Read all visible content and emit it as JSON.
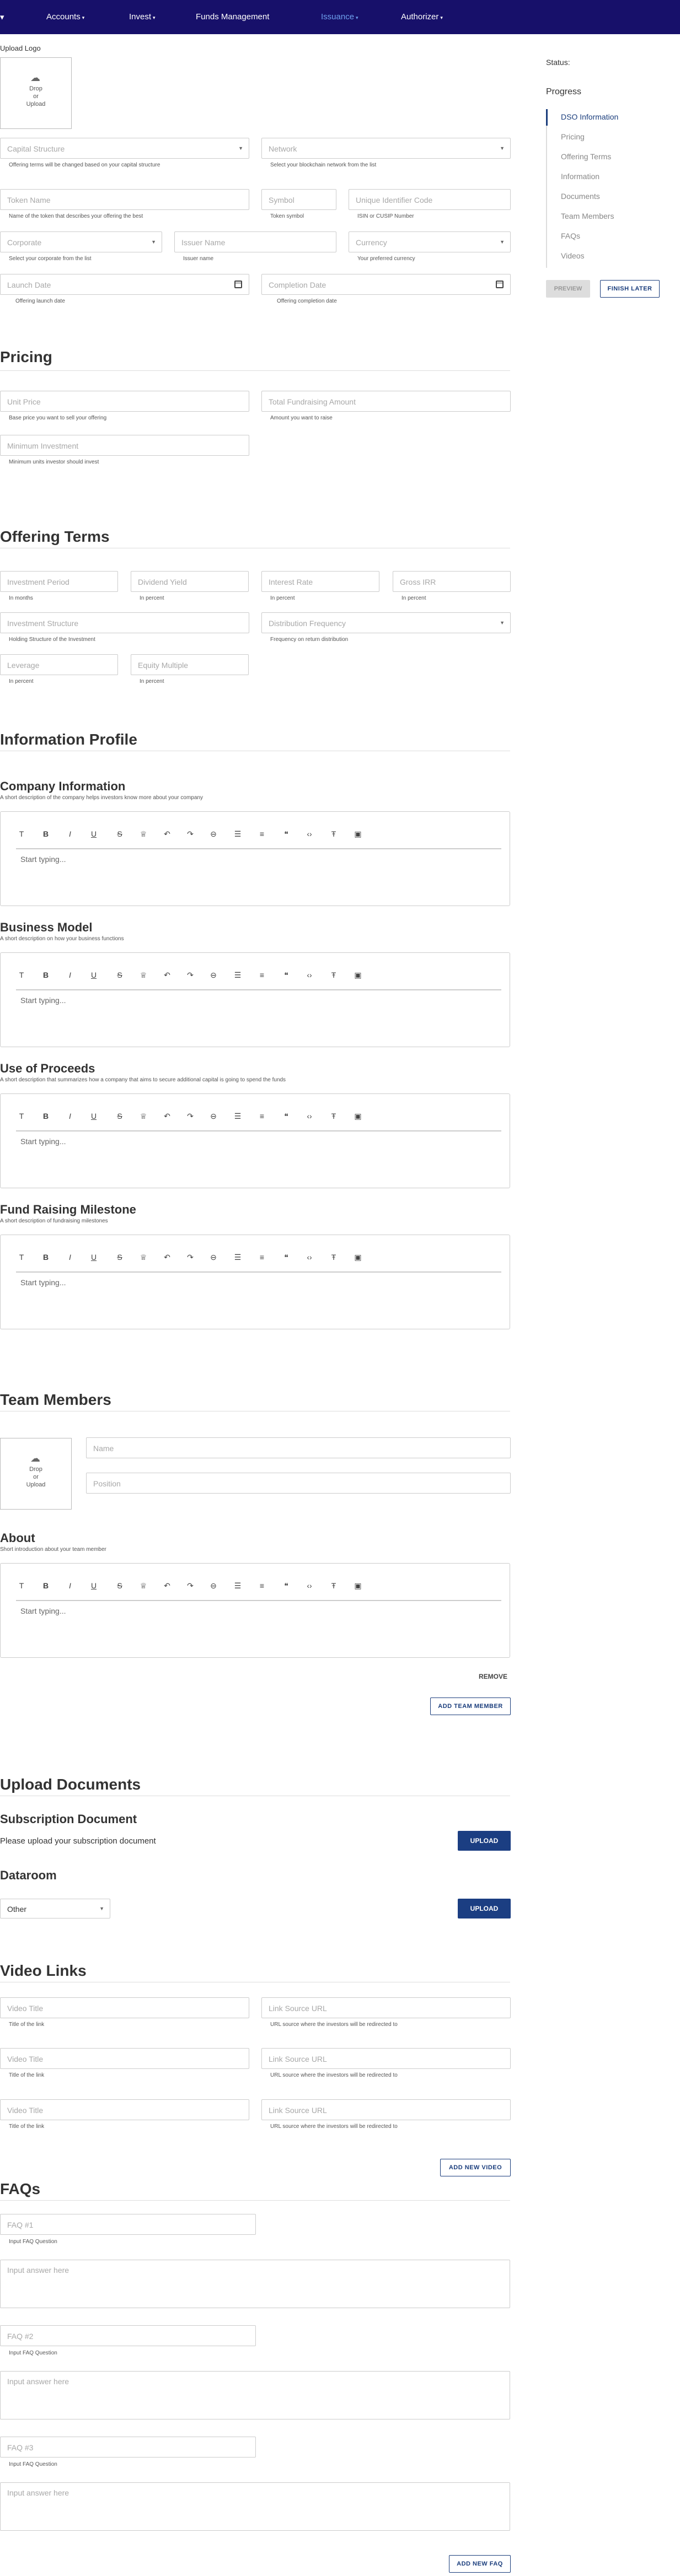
{
  "nav": [
    {
      "label": "Accounts"
    },
    {
      "label": "Invest"
    },
    {
      "label": "Funds Management"
    },
    {
      "label": "Issuance"
    },
    {
      "label": "Authorizer"
    }
  ],
  "upload_logo": {
    "label": "Upload Logo",
    "drop": "Drop",
    "or": "or",
    "upload": "Upload"
  },
  "dso": {
    "capital_structure": {
      "placeholder": "Capital Structure",
      "help": "Offering terms will be changed based on your capital structure"
    },
    "network": {
      "placeholder": "Network",
      "help": "Select your blockchain network from the list"
    },
    "token_name": {
      "placeholder": "Token Name",
      "help": "Name of the token that describes your offering the best"
    },
    "symbol": {
      "placeholder": "Symbol",
      "help": "Token symbol"
    },
    "uid": {
      "placeholder": "Unique Identifier Code",
      "help": "ISIN or CUSIP Number"
    },
    "corporate": {
      "placeholder": "Corporate",
      "help": "Select your corporate from the list"
    },
    "issuer": {
      "placeholder": "Issuer Name",
      "help": "Issuer name"
    },
    "currency": {
      "placeholder": "Currency",
      "help": "Your preferred currency"
    },
    "launch": {
      "placeholder": "Launch Date",
      "help": "Offering launch date"
    },
    "completion": {
      "placeholder": "Completion Date",
      "help": "Offering completion date"
    }
  },
  "pricing": {
    "title": "Pricing",
    "unit_price": {
      "placeholder": "Unit Price",
      "help": "Base price you want to sell your offering"
    },
    "total": {
      "placeholder": "Total Fundraising Amount",
      "help": "Amount you want to raise"
    },
    "minimum": {
      "placeholder": "Minimum Investment",
      "help": "Minimum units investor should invest"
    }
  },
  "offering": {
    "title": "Offering Terms",
    "period": {
      "placeholder": "Investment Period",
      "help": "In months"
    },
    "dividend": {
      "placeholder": "Dividend Yield",
      "help": "In percent"
    },
    "interest": {
      "placeholder": "Interest Rate",
      "help": "In percent"
    },
    "irr": {
      "placeholder": "Gross IRR",
      "help": "In percent"
    },
    "structure": {
      "placeholder": "Investment Structure",
      "help": "Holding Structure of the Investment"
    },
    "distribution": {
      "placeholder": "Distribution Frequency",
      "help": "Frequency on return distribution"
    },
    "leverage": {
      "placeholder": "Leverage",
      "help": "In percent"
    },
    "equity": {
      "placeholder": "Equity Multiple",
      "help": "In percent"
    }
  },
  "info": {
    "title": "Information Profile",
    "start": "Start typing...",
    "company": {
      "title": "Company Information",
      "desc": "A short description of the company helps investors know more about your company"
    },
    "business": {
      "title": "Business Model",
      "desc": "A short description on how your business functions"
    },
    "proceeds": {
      "title": "Use of Proceeds",
      "desc": "A short description that summarizes how a company that aims to secure additional capital is going to spend the funds"
    },
    "milestone": {
      "title": "Fund Raising Milestone",
      "desc": "A short description of fundraising milestones"
    }
  },
  "team": {
    "title": "Team Members",
    "name": "Name",
    "position": "Position",
    "about_title": "About",
    "about_desc": "Short introduction about your team member",
    "remove": "REMOVE",
    "add": "ADD TEAM MEMBER"
  },
  "documents": {
    "title": "Upload Documents",
    "sub_title": "Subscription Document",
    "sub_desc": "Please upload your subscription document",
    "upload": "UPLOAD",
    "dataroom_title": "Dataroom",
    "dataroom_value": "Other"
  },
  "videos": {
    "title": "Video Links",
    "video_title": "Video Title",
    "video_help": "Title of the link",
    "link": "Link Source URL",
    "link_help": "URL source where the investors will be redirected to",
    "add": "ADD NEW VIDEO"
  },
  "faqs": {
    "title": "FAQs",
    "q1": "FAQ #1",
    "q2": "FAQ #2",
    "q3": "FAQ #3",
    "q_help": "Input FAQ Question",
    "answer": "Input answer here",
    "add": "ADD NEW FAQ"
  },
  "sidebar": {
    "status": "Status:",
    "progress": "Progress",
    "items": [
      "DSO Information",
      "Pricing",
      "Offering Terms",
      "Information",
      "Documents",
      "Team Members",
      "FAQs",
      "Videos"
    ],
    "preview": "PREVIEW",
    "finish": "FINISH LATER"
  }
}
